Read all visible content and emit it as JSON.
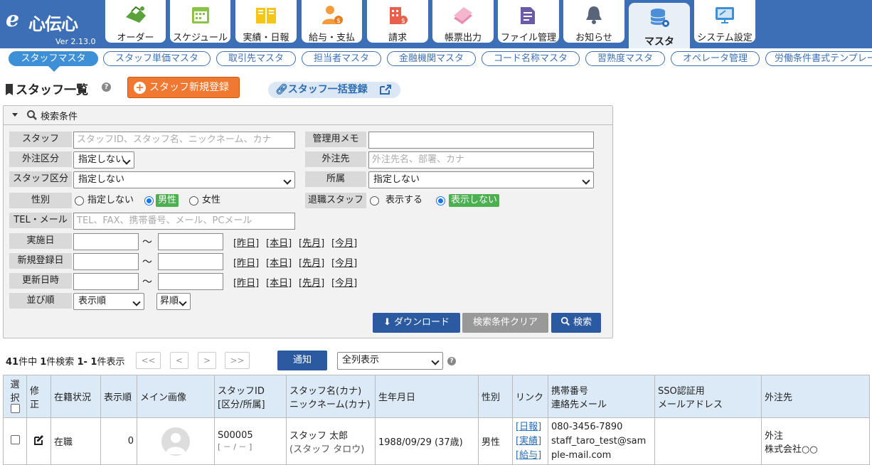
{
  "app": {
    "logo_mark": "e",
    "logo_name": "心伝心",
    "version": "Ver 2.13.0"
  },
  "top_tabs": [
    {
      "label": "オーダー",
      "icon": "handshake-icon"
    },
    {
      "label": "スケジュール",
      "icon": "calendar-icon"
    },
    {
      "label": "実績・日報",
      "icon": "book-icon"
    },
    {
      "label": "給与・支払",
      "icon": "person-coin-icon"
    },
    {
      "label": "請求",
      "icon": "building-coin-icon"
    },
    {
      "label": "帳票出力",
      "icon": "documents-icon"
    },
    {
      "label": "ファイル管理",
      "icon": "folder-icon"
    },
    {
      "label": "お知らせ",
      "icon": "bell-icon"
    },
    {
      "label": "マスタ",
      "icon": "database-gear-icon",
      "active": true
    },
    {
      "label": "システム設定",
      "icon": "monitor-settings-icon"
    }
  ],
  "sub_tabs": [
    {
      "label": "スタッフマスタ",
      "active": true
    },
    {
      "label": "スタッフ単価マスタ"
    },
    {
      "label": "取引先マスタ"
    },
    {
      "label": "担当者マスタ"
    },
    {
      "label": "金融機関マスタ"
    },
    {
      "label": "コード名称マスタ"
    },
    {
      "label": "習熟度マスタ"
    },
    {
      "label": "オペレータ管理"
    },
    {
      "label": "労働条件書式テンプレー"
    }
  ],
  "page": {
    "title": "スタッフ一覧",
    "help": "?",
    "new_button": "スタッフ新規登録",
    "bulk_button": "スタッフ一括登録"
  },
  "search": {
    "header": "検索条件",
    "staff_label": "スタッフ",
    "staff_placeholder": "スタッフID、スタッフ名、ニックネーム、カナ",
    "memo_label": "管理用メモ",
    "memo_value": "",
    "gaichu_kubun_label": "外注区分",
    "gaichu_kubun_value": "指定しない",
    "gaichu_saki_label": "外注先",
    "gaichu_saki_placeholder": "外注先名、部署、カナ",
    "staff_kubun_label": "スタッフ区分",
    "staff_kubun_value": "指定しない",
    "shozoku_label": "所属",
    "shozoku_value": "指定しない",
    "gender_label": "性別",
    "gender_options": [
      "指定しない",
      "男性",
      "女性"
    ],
    "gender_selected": "男性",
    "retired_label": "退職スタッフ",
    "retired_options": [
      "表示する",
      "表示しない"
    ],
    "retired_selected": "表示しない",
    "tel_label": "TEL・メール",
    "tel_placeholder": "TEL、FAX、携帯番号、メール、PCメール",
    "date_rows": [
      {
        "label": "実施日"
      },
      {
        "label": "新規登録日"
      },
      {
        "label": "更新日時"
      }
    ],
    "tilde": "～",
    "date_links": [
      "[昨日]",
      "[本日]",
      "[先月]",
      "[今月]"
    ],
    "sort_label": "並び順",
    "sort_value": "表示順",
    "order_value": "昇順",
    "download_button": "ダウンロード",
    "clear_button": "検索条件クリア",
    "search_button": "検索"
  },
  "results": {
    "total": "41",
    "total_suffix": "件中",
    "matched": "1",
    "matched_suffix": "件検索",
    "range": "1- 1",
    "range_suffix": "件表示",
    "pager": [
      "<<",
      "<",
      ">",
      ">>"
    ],
    "notify_button": "通知",
    "column_select": "全列表示"
  },
  "table": {
    "headers": {
      "select": "選択",
      "edit": "修正",
      "status": "在籍状況",
      "order": "表示順",
      "image": "メイン画像",
      "staff_id": "スタッフID",
      "staff_id_sub": "[区分/所属]",
      "name": "スタッフ名(カナ)",
      "name_sub": "ニックネーム(カナ)",
      "birthday": "生年月日",
      "gender": "性別",
      "link": "リンク",
      "phone": "携帯番号",
      "phone_sub": "連絡先メール",
      "sso": "SSO認証用",
      "sso_sub": "メールアドレス",
      "gaichu": "外注先"
    },
    "rows": [
      {
        "status": "在職",
        "order": "0",
        "staff_id": "S00005",
        "staff_id_sub": "[ － / － ]",
        "name": "スタッフ 太郎",
        "kana": "(スタッフ タロウ)",
        "birthday": "1988/09/29 (37歳)",
        "gender": "男性",
        "links": [
          "[日報]",
          "[実績]",
          "[給与]"
        ],
        "phone": "080-3456-7890",
        "email": "staff_taro_test@sample-mail.com",
        "sso": "",
        "gaichu": "外注",
        "gaichu2": "株式会社○○"
      }
    ]
  }
}
